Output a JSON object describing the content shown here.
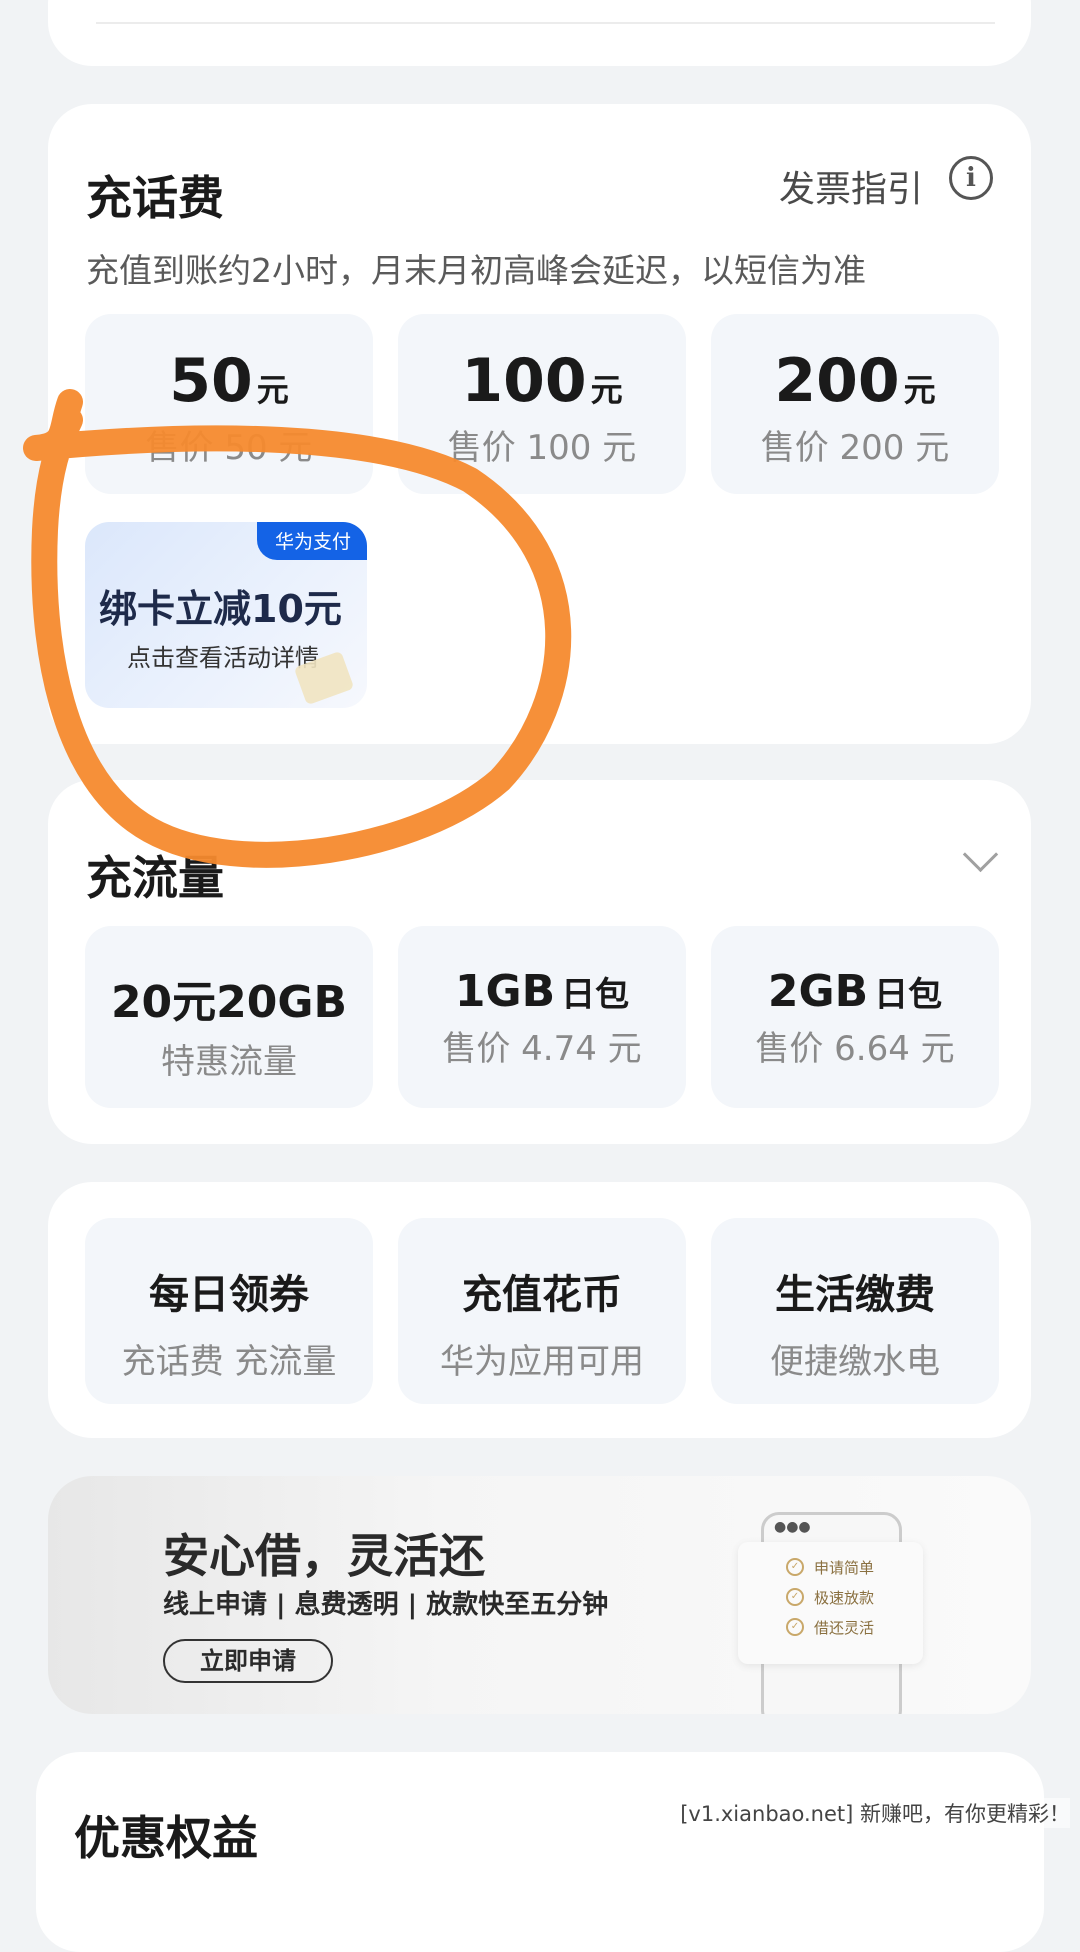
{
  "phone_recharge": {
    "title": "充话费",
    "invoice_link": "发票指引",
    "info_icon": "i",
    "note": "充值到账约2小时，月末月初高峰会延迟，以短信为准",
    "options": [
      {
        "amount": "50",
        "unit": "元",
        "price": "售价 50 元"
      },
      {
        "amount": "100",
        "unit": "元",
        "price": "售价 100 元"
      },
      {
        "amount": "200",
        "unit": "元",
        "price": "售价 200 元"
      }
    ],
    "promo": {
      "tag": "华为支付",
      "title": "绑卡立减10元",
      "subtitle": "点击查看活动详情"
    }
  },
  "data_recharge": {
    "title": "充流量",
    "options": [
      {
        "amount": "20元20GB",
        "unit": "",
        "desc": "特惠流量"
      },
      {
        "amount": "1GB",
        "unit": "日包",
        "desc": "售价 4.74 元"
      },
      {
        "amount": "2GB",
        "unit": "日包",
        "desc": "售价 6.64 元"
      }
    ]
  },
  "services": [
    {
      "name": "每日领券",
      "desc": "充话费 充流量"
    },
    {
      "name": "充值花币",
      "desc": "华为应用可用"
    },
    {
      "name": "生活缴费",
      "desc": "便捷缴水电"
    }
  ],
  "loan_banner": {
    "title": "安心借，灵活还",
    "subtitle": "线上申请 | 息费透明 | 放款快至五分钟",
    "button": "立即申请",
    "phone_status": "●●●",
    "checklist": [
      "申请简单",
      "极速放款",
      "借还灵活"
    ]
  },
  "benefits": {
    "title": "优惠权益"
  },
  "watermark": "[v1.xianbao.net] 新赚吧，有你更精彩！",
  "colors": {
    "annotation": "#f58a2e",
    "tag_blue": "#1463e6",
    "tile_bg": "#f3f6fa"
  }
}
